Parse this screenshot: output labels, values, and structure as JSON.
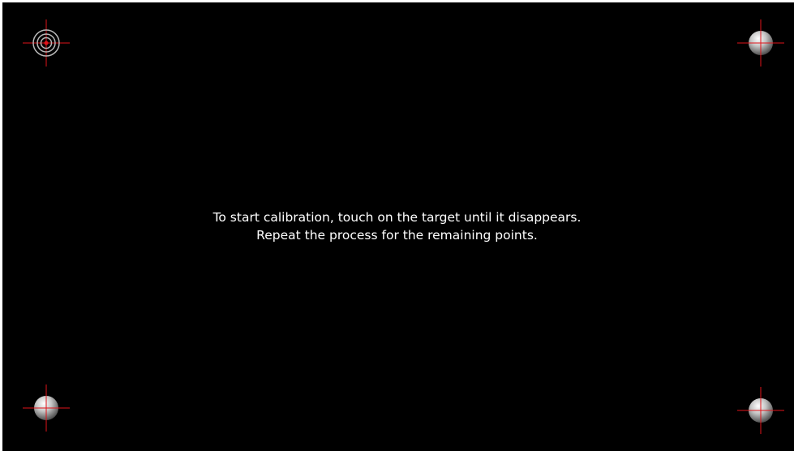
{
  "instructions": {
    "line1": "To start calibration, touch on the target until it disappears.",
    "line2": "Repeat the process for the remaining points."
  },
  "targets": [
    {
      "name": "top-left",
      "state": "active",
      "icon": "active-target-icon"
    },
    {
      "name": "top-right",
      "state": "pending",
      "icon": "pending-target-icon"
    },
    {
      "name": "bottom-left",
      "state": "pending",
      "icon": "pending-target-icon"
    },
    {
      "name": "bottom-right",
      "state": "pending",
      "icon": "pending-target-icon"
    }
  ],
  "colors": {
    "background": "#000000",
    "text": "#ffffff",
    "crosshair": "#e0141a"
  }
}
